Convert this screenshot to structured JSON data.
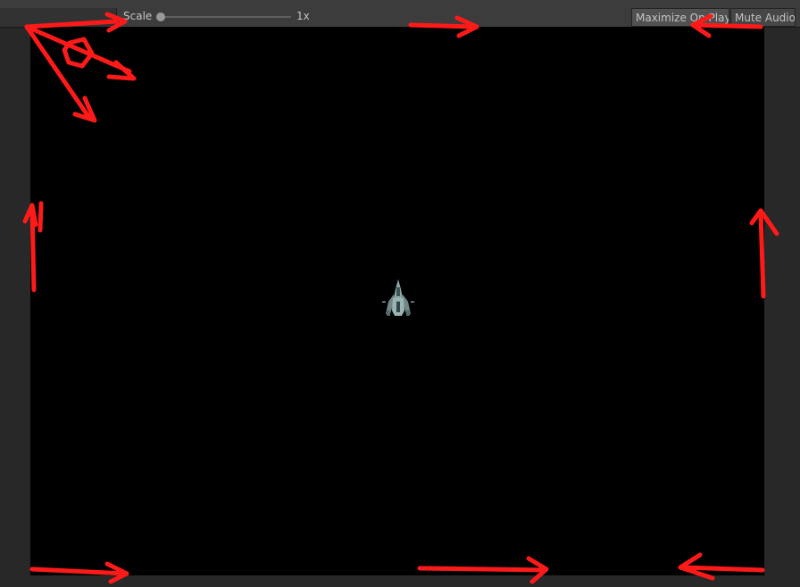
{
  "toolbar": {
    "scale_label": "Scale",
    "scale_value": "1x",
    "scale_level": 0,
    "maximize_label": "Maximize On Play",
    "mute_label": "Mute Audio"
  },
  "game_view": {
    "background": "#000000",
    "sprite": "spaceship-sprite"
  },
  "annotations": {
    "color": "#ff1a1a",
    "icons": [
      "arrow-icon",
      "circle-icon"
    ]
  }
}
